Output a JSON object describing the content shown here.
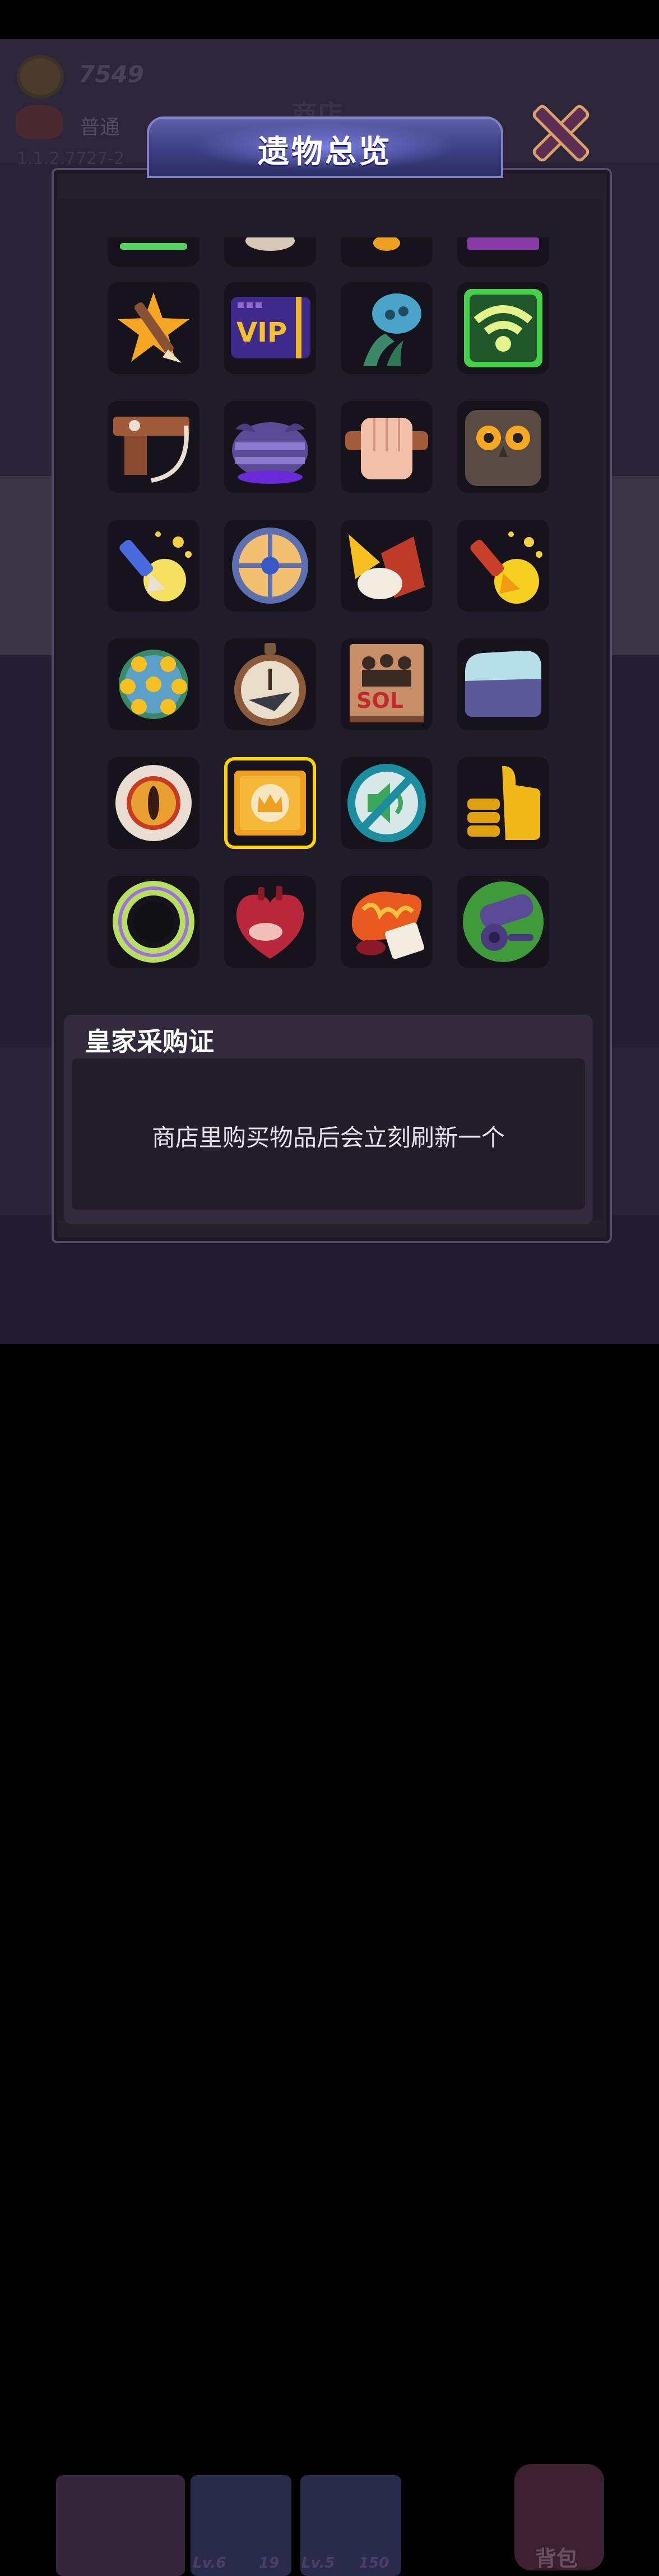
{
  "background": {
    "coins": "7549",
    "mode": "普通",
    "version": "1.1.2.7727-2",
    "shop_title": "商店",
    "bottom_bar": {
      "slot1_level": "Lv.6",
      "slot1_count": "19",
      "slot2_level": "Lv.5",
      "slot2_count": "150",
      "bag_label": "背包"
    }
  },
  "dialog": {
    "title": "遗物总览",
    "close_icon": "close-x-icon"
  },
  "relics": [
    {
      "name": "relic-green-bar-icon"
    },
    {
      "name": "relic-round-beige-icon"
    },
    {
      "name": "relic-orange-icon"
    },
    {
      "name": "relic-purple-icon"
    },
    {
      "name": "crossbow-star-icon"
    },
    {
      "name": "vip-card-icon",
      "label": "VIP"
    },
    {
      "name": "tentacle-skull-icon"
    },
    {
      "name": "wifi-screen-icon"
    },
    {
      "name": "hook-weapon-icon"
    },
    {
      "name": "purple-helmet-icon"
    },
    {
      "name": "fist-icon"
    },
    {
      "name": "owl-box-icon"
    },
    {
      "name": "glowing-arrow-icon"
    },
    {
      "name": "round-shield-icon"
    },
    {
      "name": "meat-axe-icon"
    },
    {
      "name": "golden-arrow-icon"
    },
    {
      "name": "spiky-ball-icon"
    },
    {
      "name": "stopwatch-icon"
    },
    {
      "name": "book-icon",
      "label": "SOL"
    },
    {
      "name": "ice-block-icon"
    },
    {
      "name": "eye-ring-icon"
    },
    {
      "name": "royal-certificate-icon",
      "selected": true
    },
    {
      "name": "mute-icon"
    },
    {
      "name": "thumbs-up-icon"
    },
    {
      "name": "rainbow-ring-icon"
    },
    {
      "name": "heart-icon"
    },
    {
      "name": "fire-glove-icon"
    },
    {
      "name": "cannon-icon"
    }
  ],
  "selected_relic": {
    "title": "皇家采购证",
    "description": "商店里购买物品后会立刻刷新一个"
  }
}
